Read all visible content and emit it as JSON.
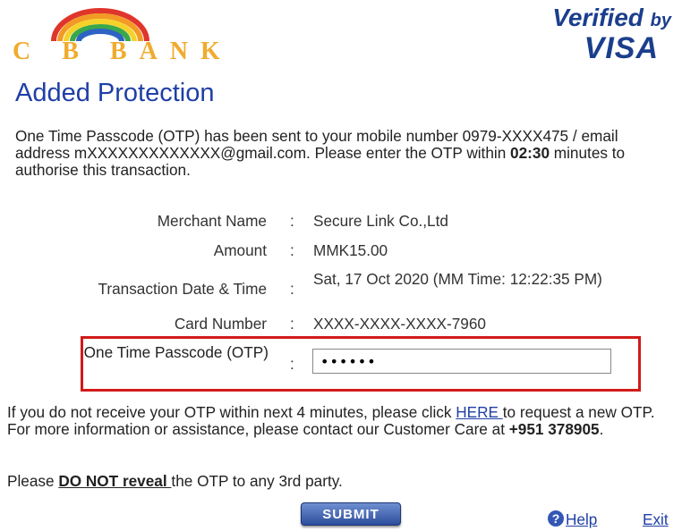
{
  "bank": {
    "logo_text": "C B BANK"
  },
  "brand": {
    "top": "Verified",
    "by": "by",
    "name": "VISA"
  },
  "page_title": "Added Protection",
  "intro": {
    "text_1": "One Time Passcode (OTP) has been sent to your mobile number 0979-XXXX475 / email address mXXXXXXXXXXXXX@gmail.com. Please enter the OTP within ",
    "timer": "02:30",
    "text_2": " minutes to authorise this transaction."
  },
  "details": {
    "merchant_label": "Merchant Name",
    "merchant_value": "Secure Link Co.,Ltd",
    "amount_label": "Amount",
    "amount_value": "MMK15.00",
    "date_label": "Transaction Date & Time",
    "date_value": "Sat, 17 Oct 2020 (MM Time: 12:22:35 PM)",
    "card_label": "Card Number",
    "card_value": "XXXX-XXXX-XXXX-7960",
    "separator": ":"
  },
  "otp": {
    "label": "One Time Passcode (OTP)",
    "value": "••••••"
  },
  "note": {
    "text_1": "If you do not receive your OTP within next 4 minutes, please click ",
    "link": "HERE ",
    "text_2": "to request a new OTP. For more information or assistance, please contact our Customer Care at ",
    "phone": "+951 378905",
    "text_3": "."
  },
  "warning": {
    "text_1": "Please ",
    "emphasis": "DO NOT reveal ",
    "text_2": "the OTP to any 3rd party."
  },
  "actions": {
    "submit_label": "SUBMIT",
    "help_label": "Help",
    "exit_label": "Exit"
  },
  "colors": {
    "accent": "#1f3fa6",
    "highlight_border": "#d11a1a",
    "bank_gold": "#f0ab2e"
  }
}
